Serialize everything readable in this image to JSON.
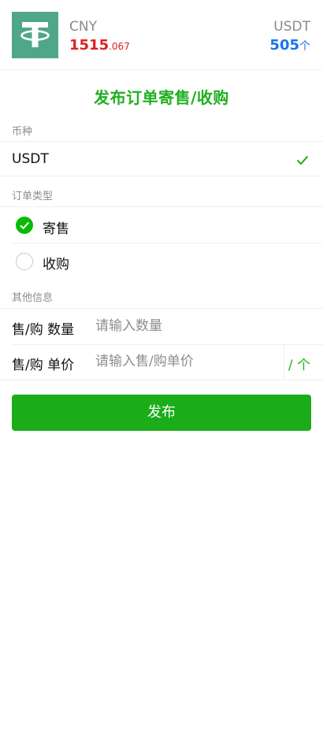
{
  "header": {
    "logo_icon": "tether-logo-icon",
    "cny_label": "CNY",
    "cny_value_int": "1515",
    "cny_value_dec": ".067",
    "usdt_label": "USDT",
    "usdt_count": "505",
    "usdt_unit": "个"
  },
  "title": "发布订单寄售/收购",
  "currency_section": {
    "label": "币种",
    "selected": "USDT",
    "selected_icon": "checkmark-icon"
  },
  "order_type_section": {
    "label": "订单类型",
    "options": [
      {
        "label": "寄售",
        "checked": true
      },
      {
        "label": "收购",
        "checked": false
      }
    ]
  },
  "other_section": {
    "label": "其他信息",
    "quantity_label": "售/购 数量",
    "quantity_value": "",
    "quantity_placeholder": "请输入数量",
    "price_label": "售/购 单价",
    "price_value": "",
    "price_placeholder": "请输入售/购单价",
    "price_unit": "/ 个"
  },
  "publish_button": "发布",
  "colors": {
    "accent_green": "#1aad19",
    "title_green": "#20b020",
    "cny_red": "#e02020",
    "usdt_blue": "#1a73e8",
    "logo_teal": "#4fa78a"
  }
}
